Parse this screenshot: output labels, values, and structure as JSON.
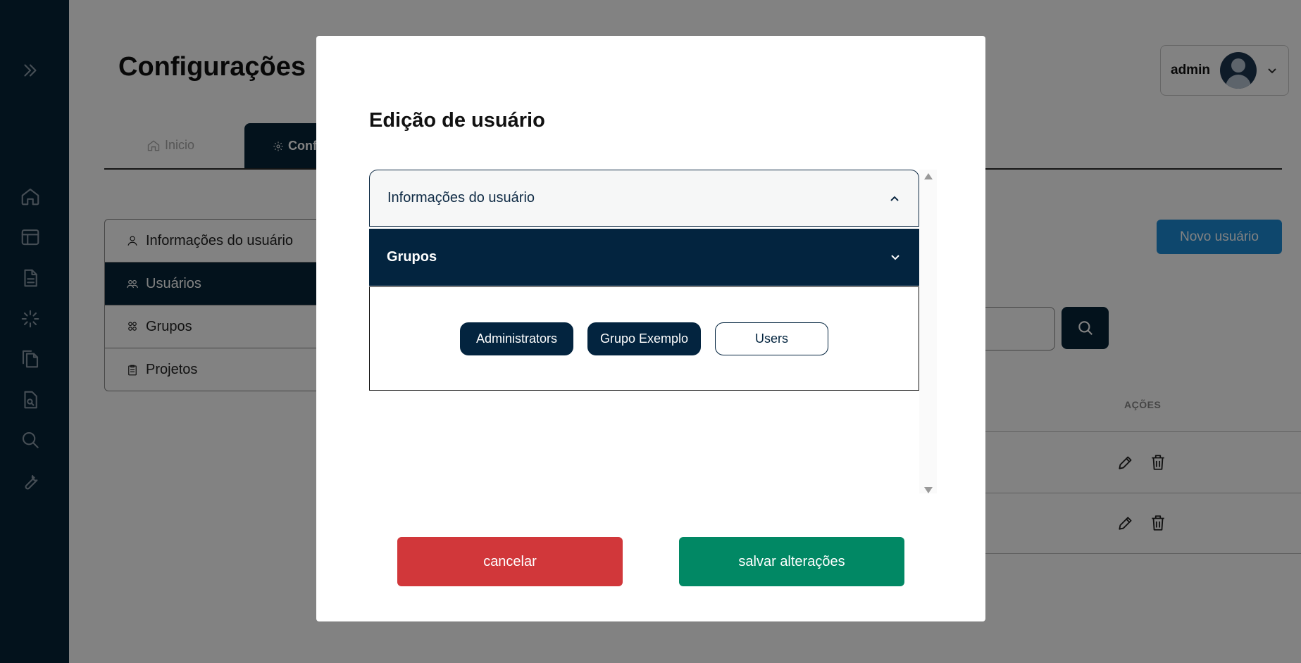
{
  "page": {
    "title": "Configurações",
    "user": {
      "name": "admin"
    },
    "tabs": [
      {
        "label": "Inicio",
        "icon": "home-icon"
      },
      {
        "label": "Conf",
        "icon": "gear-icon"
      }
    ],
    "settings_menu": [
      {
        "label": "Informações do usuário",
        "icon": "user-icon"
      },
      {
        "label": "Usuários",
        "icon": "users-icon",
        "active": true
      },
      {
        "label": "Grupos",
        "icon": "groups-icon"
      },
      {
        "label": "Projetos",
        "icon": "clipboard-icon"
      }
    ],
    "new_user_label": "Novo usuário",
    "table": {
      "actions_header": "AÇÕES"
    }
  },
  "sidebar": {
    "icons": [
      "expand-icon",
      "home-icon",
      "layout-icon",
      "document-icon",
      "loader-icon",
      "copy-document-icon",
      "document-search-icon",
      "search-icon",
      "wrench-icon"
    ]
  },
  "modal": {
    "title": "Edição de usuário",
    "accordion": [
      {
        "label": "Informações do usuário",
        "expanded": false
      },
      {
        "label": "Grupos",
        "expanded": true
      }
    ],
    "groups": [
      {
        "label": "Administrators",
        "selected": true
      },
      {
        "label": "Grupo Exemplo",
        "selected": true
      },
      {
        "label": "Users",
        "selected": false
      }
    ],
    "cancel_label": "cancelar",
    "save_label": "salvar alterações"
  },
  "colors": {
    "sidebar": "#062438",
    "primary_dark": "#03243f",
    "cancel": "#d1373a",
    "save": "#018864",
    "new_user": "#1c8cd6"
  }
}
